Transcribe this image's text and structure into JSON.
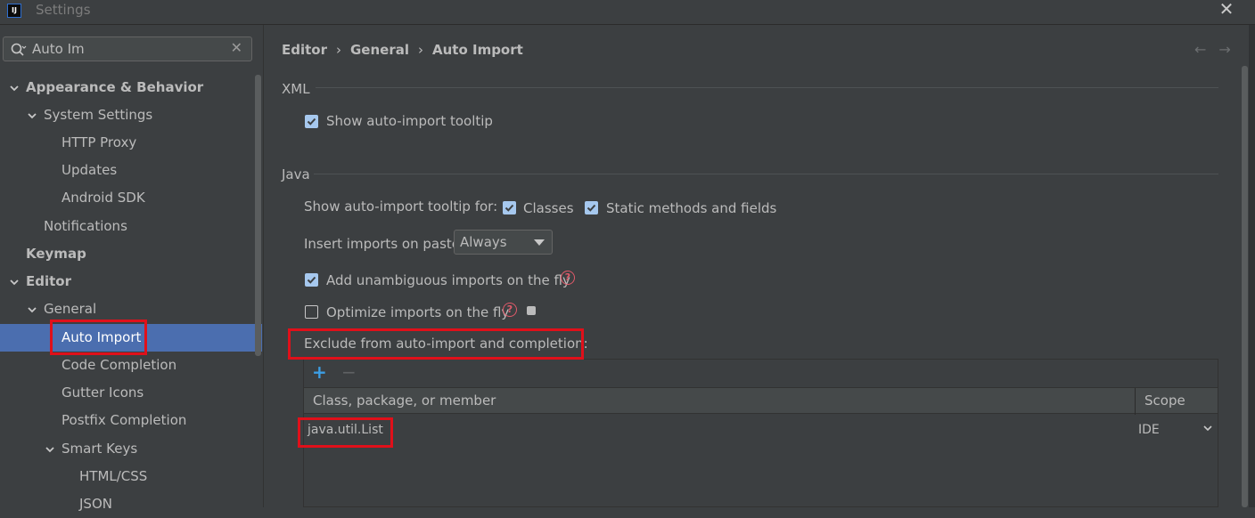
{
  "window": {
    "title": "Settings"
  },
  "search": {
    "value": "Auto Im"
  },
  "tree": [
    {
      "label": "Appearance & Behavior",
      "bold": true,
      "expanded": true,
      "depth": 0
    },
    {
      "label": "System Settings",
      "bold": false,
      "expanded": true,
      "depth": 1
    },
    {
      "label": "HTTP Proxy",
      "depth": 2
    },
    {
      "label": "Updates",
      "depth": 2
    },
    {
      "label": "Android SDK",
      "depth": 2
    },
    {
      "label": "Notifications",
      "depth": 1
    },
    {
      "label": "Keymap",
      "bold": true,
      "depth": 0
    },
    {
      "label": "Editor",
      "bold": true,
      "expanded": true,
      "depth": 0
    },
    {
      "label": "General",
      "expanded": true,
      "depth": 1
    },
    {
      "label": "Auto Import",
      "selected": true,
      "depth": 2
    },
    {
      "label": "Code Completion",
      "depth": 2
    },
    {
      "label": "Gutter Icons",
      "depth": 2
    },
    {
      "label": "Postfix Completion",
      "depth": 2
    },
    {
      "label": "Smart Keys",
      "expanded": true,
      "depth": 2
    },
    {
      "label": "HTML/CSS",
      "depth": 3
    },
    {
      "label": "JSON",
      "depth": 3
    }
  ],
  "breadcrumb": [
    "Editor",
    "General",
    "Auto Import"
  ],
  "xml": {
    "section_title": "XML",
    "show_tooltip": {
      "label": "Show auto-import tooltip",
      "checked": true
    }
  },
  "java": {
    "section_title": "Java",
    "tooltip_for_label": "Show auto-import tooltip for:",
    "classes": {
      "label": "Classes",
      "checked": true
    },
    "static_methods": {
      "label": "Static methods and fields",
      "checked": true
    },
    "insert_on_paste_label": "Insert imports on paste:",
    "insert_on_paste_value": "Always",
    "add_unambiguous": {
      "label": "Add unambiguous imports on the fly",
      "checked": true
    },
    "optimize_imports": {
      "label": "Optimize imports on the fly",
      "checked": false
    },
    "exclude_label": "Exclude from auto-import and completion:",
    "table": {
      "columns": [
        "Class, package, or member",
        "Scope"
      ],
      "rows": [
        {
          "name": "java.util.List",
          "scope": "IDE"
        }
      ]
    }
  },
  "colors": {
    "accent": "#4b6eaf",
    "highlight": "#e0101a",
    "background": "#3c3f41"
  }
}
